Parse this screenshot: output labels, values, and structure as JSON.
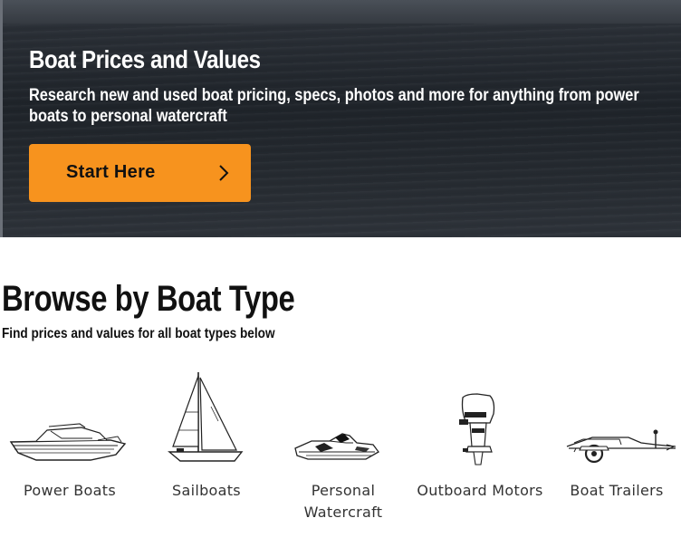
{
  "hero": {
    "title": "Boat Prices and Values",
    "subtitle": "Research new and used boat pricing, specs, photos and more for anything from power boats to personal watercraft",
    "cta_label": "Start Here",
    "cta_icon": "chevron-right-icon",
    "cta_color": "#f7931e"
  },
  "browse": {
    "title": "Browse by Boat Type",
    "subtitle": "Find prices and values for all boat types below",
    "types": [
      {
        "label": "Power Boats",
        "icon": "power-boat-icon"
      },
      {
        "label": "Sailboats",
        "icon": "sailboat-icon"
      },
      {
        "label": "Personal Watercraft",
        "icon": "personal-watercraft-icon"
      },
      {
        "label": "Outboard Motors",
        "icon": "outboard-motor-icon"
      },
      {
        "label": "Boat Trailers",
        "icon": "boat-trailer-icon"
      }
    ]
  }
}
